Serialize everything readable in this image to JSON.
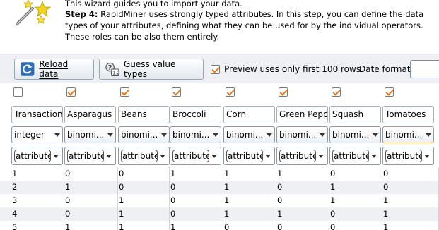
{
  "header": {
    "intro": "This wizard guides you to import your data.",
    "step_label": "Step 4:",
    "step_text": " RapidMiner uses strongly typed attributes. In this step, you can define the data types of your attributes, defining what they can be used for by the individual operators. These roles can be also them entirely."
  },
  "toolbar": {
    "reload_label": "Reload data",
    "guess_label": "Guess value types",
    "preview_label": "Preview uses only first 100 rows.",
    "preview_checked": true,
    "date_format_label": "Date format"
  },
  "columns": [
    {
      "name": "Transaction",
      "type": "integer",
      "role": "attribute",
      "checked": false
    },
    {
      "name": "Asparagus",
      "type": "binomi...",
      "role": "attribute",
      "checked": true
    },
    {
      "name": "Beans",
      "type": "binomi...",
      "role": "attribute",
      "checked": true
    },
    {
      "name": "Broccoli",
      "type": "binomi...",
      "role": "attribute",
      "checked": true
    },
    {
      "name": "Corn",
      "type": "binomi...",
      "role": "attribute",
      "checked": true
    },
    {
      "name": "Green Pepp",
      "type": "binomi...",
      "role": "attribute",
      "checked": true
    },
    {
      "name": "Squash",
      "type": "binomi...",
      "role": "attribute",
      "checked": true
    },
    {
      "name": "Tomatoes",
      "type": "binomi...",
      "role": "attribute",
      "checked": true
    }
  ],
  "rows": [
    [
      "1",
      "0",
      "0",
      "1",
      "1",
      "1",
      "0",
      "0"
    ],
    [
      "2",
      "1",
      "0",
      "0",
      "1",
      "0",
      "1",
      "0"
    ],
    [
      "3",
      "0",
      "1",
      "0",
      "1",
      "0",
      "1",
      "1"
    ],
    [
      "4",
      "0",
      "1",
      "0",
      "1",
      "1",
      "0",
      "1"
    ],
    [
      "5",
      "1",
      "1",
      "1",
      "0",
      "0",
      "0",
      "1"
    ]
  ],
  "colors": {
    "check_accent": "#e07a22",
    "focus_border": "#e08a3a",
    "row_alt": "#eef0f4",
    "toolbar_bg": "#eef0f3"
  },
  "icons": {
    "wizard": "magic-wand-icon",
    "reload": "reload-icon",
    "guess": "guess-types-icon"
  }
}
